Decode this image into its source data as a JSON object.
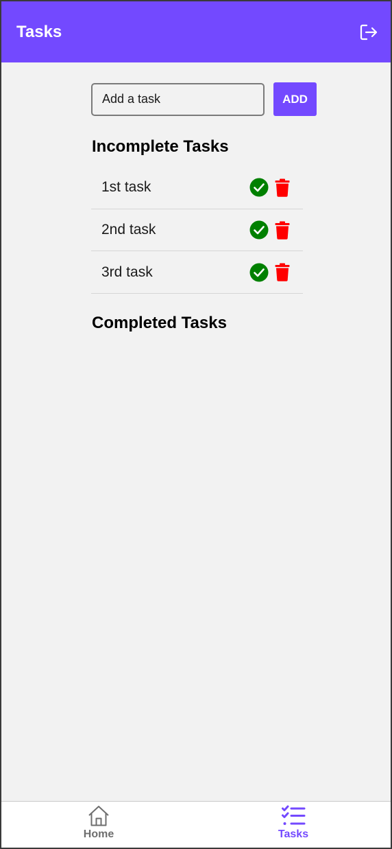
{
  "header": {
    "title": "Tasks",
    "logout_icon": "logout-icon"
  },
  "add_task": {
    "placeholder": "Add a task",
    "value": "",
    "button_label": "ADD"
  },
  "incomplete": {
    "title": "Incomplete Tasks",
    "tasks": [
      {
        "text": "1st task"
      },
      {
        "text": "2nd task"
      },
      {
        "text": "3rd task"
      }
    ]
  },
  "completed": {
    "title": "Completed Tasks",
    "tasks": []
  },
  "nav": {
    "items": [
      {
        "label": "Home",
        "icon": "home-icon",
        "active": false
      },
      {
        "label": "Tasks",
        "icon": "tasks-list-icon",
        "active": true
      }
    ]
  },
  "colors": {
    "accent": "#7349ff",
    "complete": "#008000",
    "delete": "#ff0000",
    "background": "#f2f2f2"
  }
}
